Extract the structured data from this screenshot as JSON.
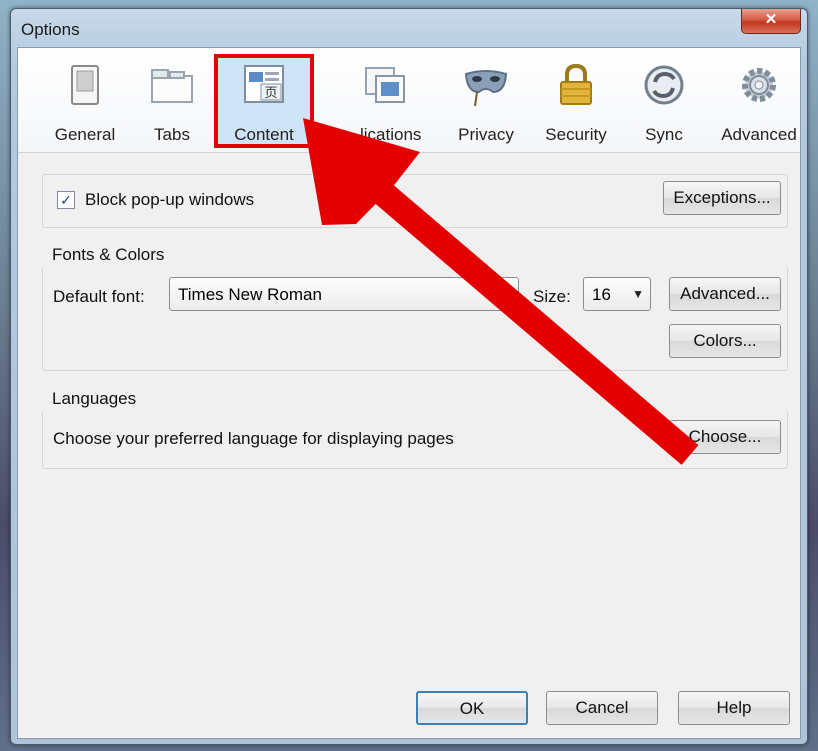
{
  "window": {
    "title": "Options",
    "close_label": "✕"
  },
  "tabs": [
    {
      "label": "General",
      "icon": "switch-icon"
    },
    {
      "label": "Tabs",
      "icon": "tabs-icon"
    },
    {
      "label": "Content",
      "icon": "content-icon"
    },
    {
      "label": "Applications",
      "label_visible": "lications",
      "icon": "applications-icon"
    },
    {
      "label": "Privacy",
      "icon": "mask-icon"
    },
    {
      "label": "Security",
      "icon": "lock-icon"
    },
    {
      "label": "Sync",
      "icon": "sync-icon"
    },
    {
      "label": "Advanced",
      "icon": "gear-icon"
    }
  ],
  "selected_tab": "Content",
  "popup": {
    "checkbox_label": "Block pop-up windows",
    "checked": true,
    "exceptions_button": "Exceptions..."
  },
  "fonts": {
    "group_title": "Fonts & Colors",
    "default_font_label": "Default font:",
    "default_font_value": "Times New Roman",
    "size_label": "Size:",
    "size_value": "16",
    "advanced_button": "Advanced...",
    "colors_button": "Colors..."
  },
  "languages": {
    "group_title": "Languages",
    "description": "Choose your preferred language for displaying pages",
    "choose_button": "Choose..."
  },
  "footer": {
    "ok": "OK",
    "cancel": "Cancel",
    "help": "Help"
  },
  "colors": {
    "annotation_red": "#e30000",
    "selected_tab_bg": "#cfe3f6"
  }
}
